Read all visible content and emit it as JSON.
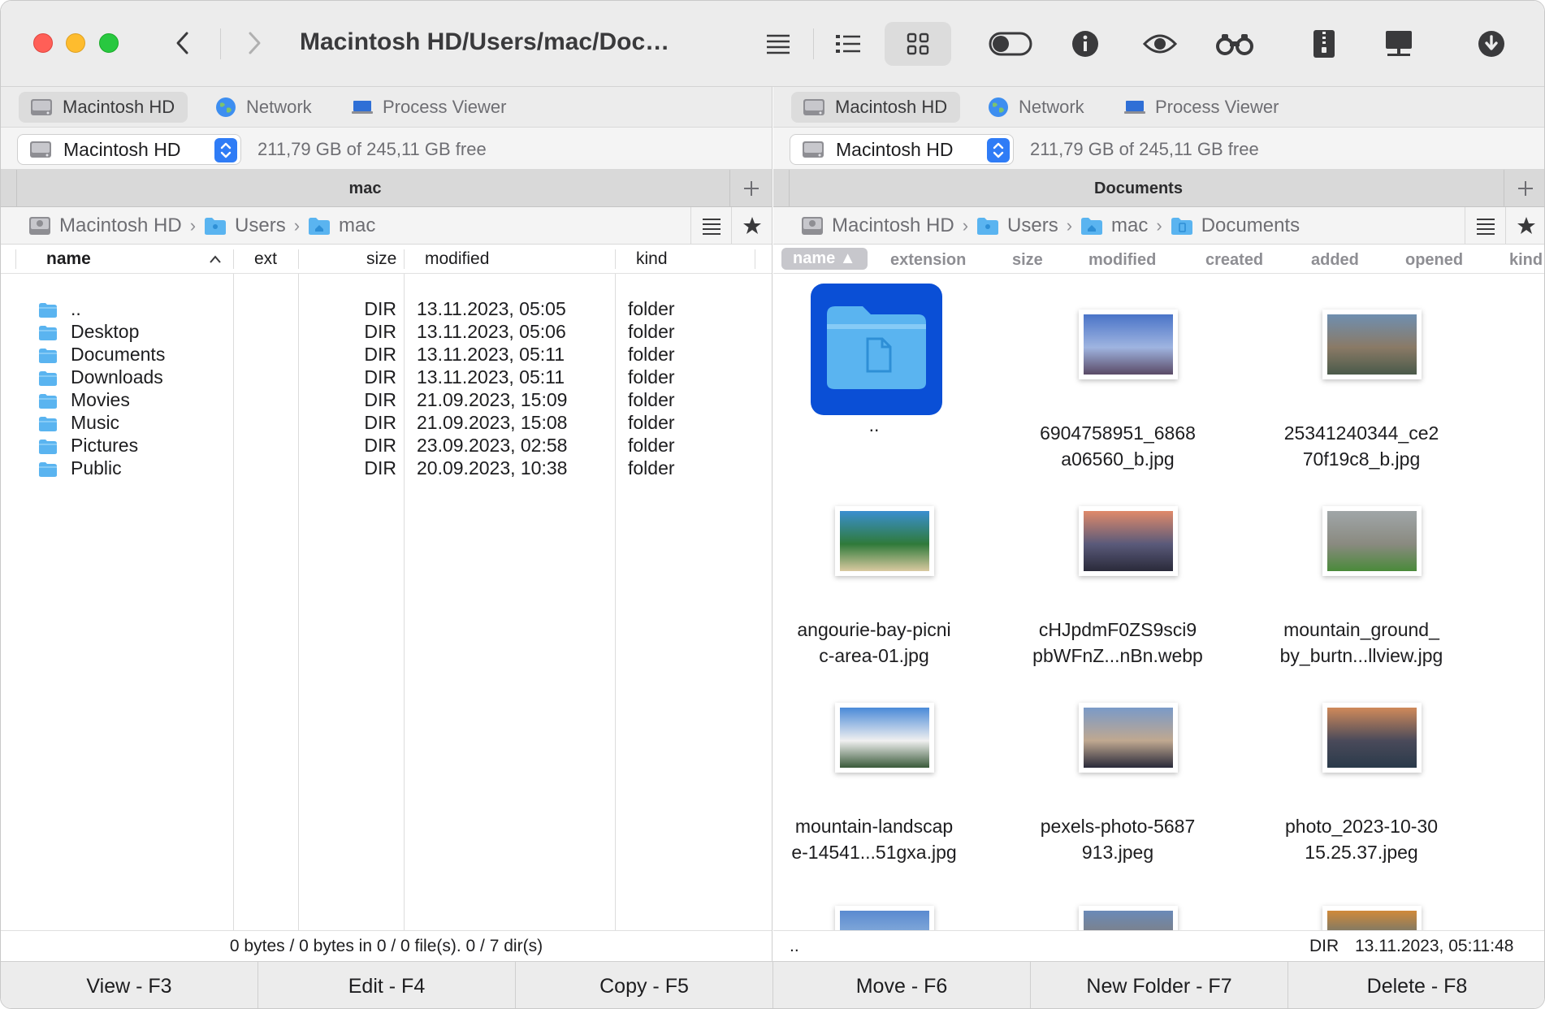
{
  "toolbar": {
    "path_title": "Macintosh HD/Users/mac/Doc…"
  },
  "left": {
    "tabs": [
      {
        "label": "Macintosh HD",
        "icon": "disk-icon"
      },
      {
        "label": "Network",
        "icon": "globe-icon"
      },
      {
        "label": "Process Viewer",
        "icon": "monitor-icon"
      }
    ],
    "volume": {
      "name": "Macintosh HD",
      "free": "211,79 GB of 245,11 GB free"
    },
    "title": "mac",
    "breadcrumb": [
      "Macintosh HD",
      "Users",
      "mac"
    ],
    "columns": {
      "name": "name",
      "ext": "ext",
      "size": "size",
      "modified": "modified",
      "kind": "kind"
    },
    "rows": [
      {
        "name": "..",
        "size": "DIR",
        "modified": "13.11.2023, 05:05",
        "kind": "folder"
      },
      {
        "name": "Desktop",
        "size": "DIR",
        "modified": "13.11.2023, 05:06",
        "kind": "folder"
      },
      {
        "name": "Documents",
        "size": "DIR",
        "modified": "13.11.2023, 05:11",
        "kind": "folder"
      },
      {
        "name": "Downloads",
        "size": "DIR",
        "modified": "13.11.2023, 05:11",
        "kind": "folder"
      },
      {
        "name": "Movies",
        "size": "DIR",
        "modified": "21.09.2023, 15:09",
        "kind": "folder"
      },
      {
        "name": "Music",
        "size": "DIR",
        "modified": "21.09.2023, 15:08",
        "kind": "folder"
      },
      {
        "name": "Pictures",
        "size": "DIR",
        "modified": "23.09.2023, 02:58",
        "kind": "folder"
      },
      {
        "name": "Public",
        "size": "DIR",
        "modified": "20.09.2023, 10:38",
        "kind": "folder"
      }
    ],
    "status": "0 bytes / 0 bytes in 0 / 0 file(s). 0 / 7 dir(s)"
  },
  "right": {
    "tabs": [
      {
        "label": "Macintosh HD",
        "icon": "disk-icon"
      },
      {
        "label": "Network",
        "icon": "globe-icon"
      },
      {
        "label": "Process Viewer",
        "icon": "monitor-icon"
      }
    ],
    "volume": {
      "name": "Macintosh HD",
      "free": "211,79 GB of 245,11 GB free"
    },
    "title": "Documents",
    "breadcrumb": [
      "Macintosh HD",
      "Users",
      "mac",
      "Documents"
    ],
    "columns": [
      "name",
      "extension",
      "size",
      "modified",
      "created",
      "added",
      "opened",
      "kind"
    ],
    "tiles": [
      {
        "line1": "..",
        "line2": ""
      },
      {
        "line1": "6904758951_6868",
        "line2": "a06560_b.jpg"
      },
      {
        "line1": "25341240344_ce2",
        "line2": "70f19c8_b.jpg"
      },
      {
        "line1": "angourie-bay-picni",
        "line2": "c-area-01.jpg"
      },
      {
        "line1": "cHJpdmF0ZS9sci9",
        "line2": "pbWFnZ...nBn.webp"
      },
      {
        "line1": "mountain_ground_",
        "line2": "by_burtn...llview.jpg"
      },
      {
        "line1": "mountain-landscap",
        "line2": "e-14541...51gxa.jpg"
      },
      {
        "line1": "pexels-photo-5687",
        "line2": "913.jpeg"
      },
      {
        "line1": "photo_2023-10-30",
        "line2": "15.25.37.jpeg"
      }
    ],
    "status": {
      "name": "..",
      "size": "DIR",
      "date": "13.11.2023, 05:11:48"
    }
  },
  "fkeys": [
    "View - F3",
    "Edit - F4",
    "Copy - F5",
    "Move - F6",
    "New Folder - F7",
    "Delete - F8"
  ],
  "colors": {
    "accent": "#2f7cf6",
    "folder_blue": "#5ab4f0",
    "selection": "#0a4fd6"
  }
}
